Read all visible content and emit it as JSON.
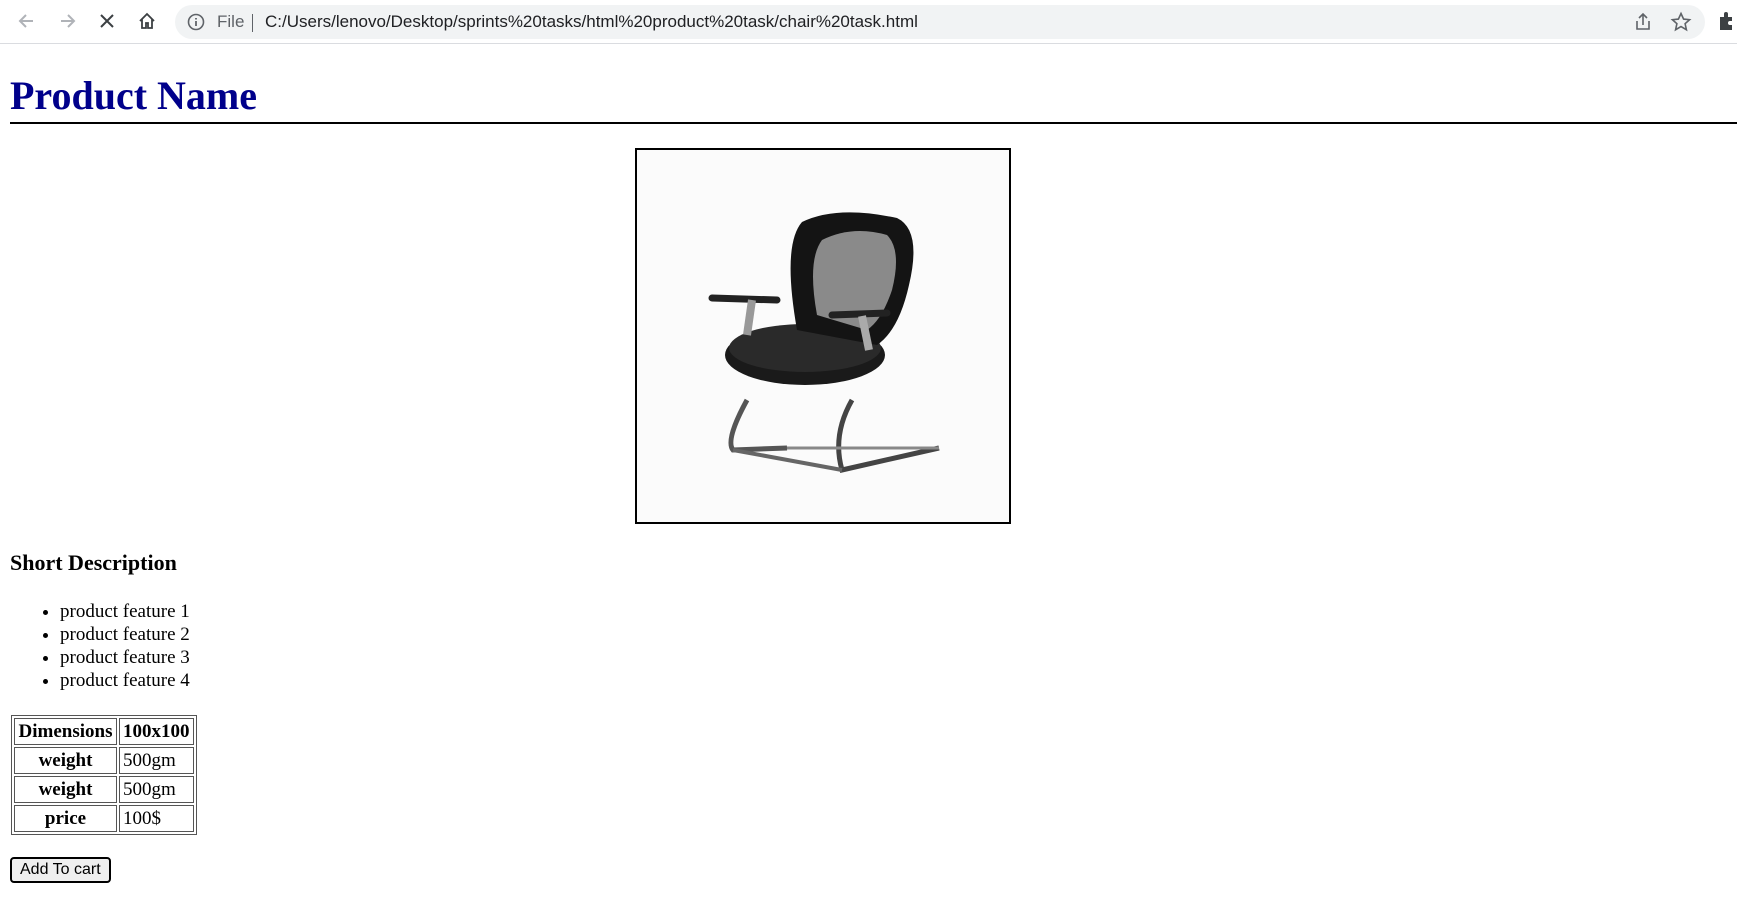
{
  "browser": {
    "back_icon": "arrow-left-icon",
    "forward_icon": "arrow-right-icon",
    "stop_icon": "close-icon",
    "home_icon": "home-icon",
    "file_label": "File",
    "url": "C:/Users/lenovo/Desktop/sprints%20tasks/html%20product%20task/chair%20task.html"
  },
  "product": {
    "title": "Product Name",
    "image_alt": "office chair",
    "description_heading": "Short Description",
    "features": [
      "product feature 1",
      "product feature 2",
      "product feature 3",
      "product feature 4"
    ],
    "specs": [
      {
        "label": "Dimensions",
        "value": "100x100"
      },
      {
        "label": "weight",
        "value": "500gm"
      },
      {
        "label": "weight",
        "value": "500gm"
      },
      {
        "label": "price",
        "value": "100$"
      }
    ],
    "cart_button": "Add To cart"
  }
}
